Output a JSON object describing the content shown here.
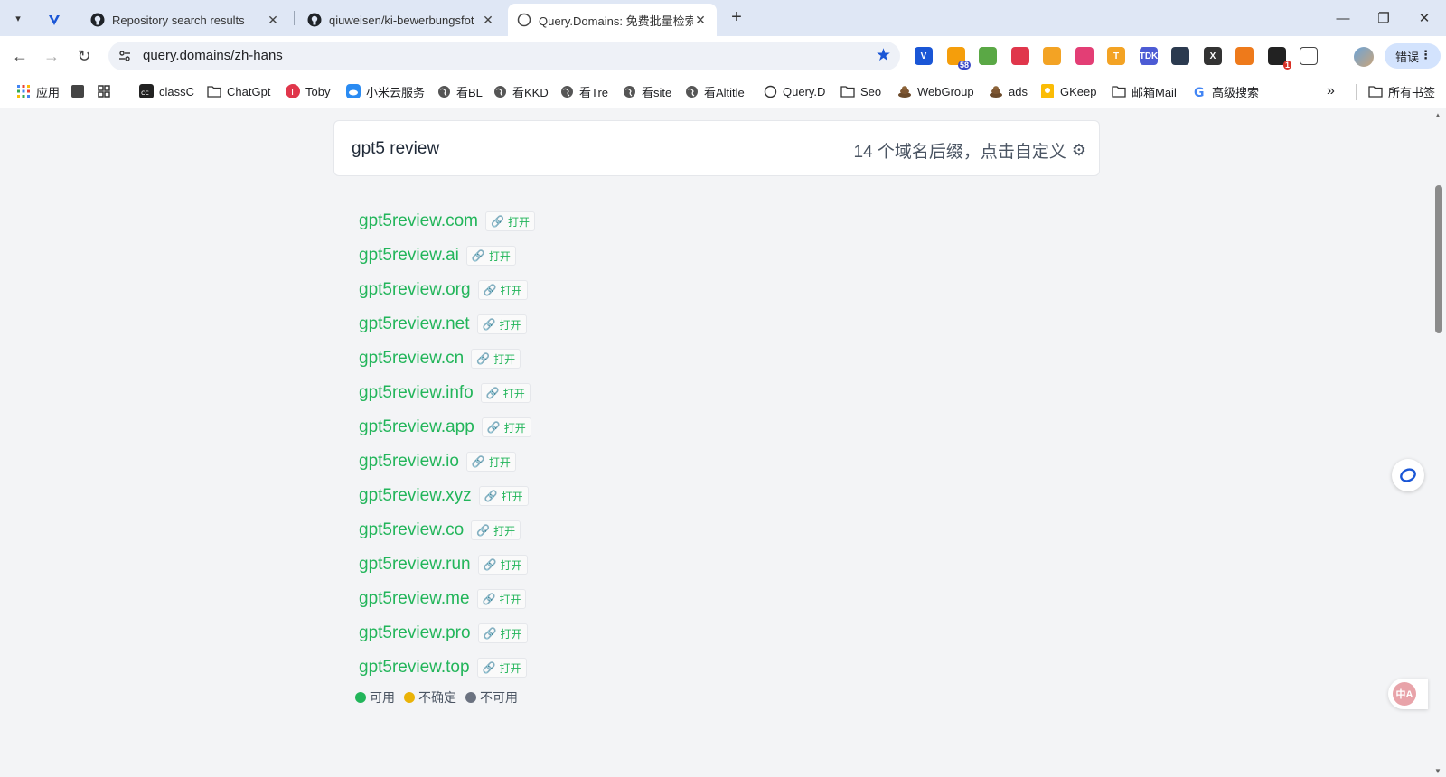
{
  "browser": {
    "tabs": [
      {
        "title": "",
        "icon": "vivaldi-like-icon"
      },
      {
        "title": "Repository search results",
        "icon": "github-icon"
      },
      {
        "title": "qiuweisen/ki-bewerbungsfot",
        "icon": "github-icon"
      },
      {
        "title": "Query.Domains: 免费批量检索",
        "icon": "globe-icon",
        "active": true
      }
    ],
    "new_tab_label": "+",
    "window_controls": {
      "minimize": "—",
      "restore": "❐",
      "close": "✕"
    }
  },
  "toolbar": {
    "url": "query.domains/zh-hans",
    "error_label": "错误",
    "extensions": [
      {
        "name": "blue-v-ext-icon",
        "color": "#1a56d6",
        "label": "V"
      },
      {
        "name": "rss-ext-icon",
        "color": "#f59e0b",
        "label": "",
        "badge": "58"
      },
      {
        "name": "green-ext-icon",
        "color": "#5aa845",
        "label": ""
      },
      {
        "name": "red-ext-icon",
        "color": "#e0364b",
        "label": ""
      },
      {
        "name": "orange-gauge-ext-icon",
        "color": "#f3a324",
        "label": ""
      },
      {
        "name": "pink-ext-icon",
        "color": "#e33e75",
        "label": ""
      },
      {
        "name": "tshape-ext-icon",
        "color": "#f3a324",
        "label": "T"
      },
      {
        "name": "tdk-ext-icon",
        "color": "#4c5bd4",
        "label": "TDK"
      },
      {
        "name": "dark-ext-icon",
        "color": "#2b3a4f",
        "label": ""
      },
      {
        "name": "x-ext-icon",
        "color": "#333333",
        "label": "X"
      },
      {
        "name": "orange-ext-icon",
        "color": "#ee7a1b",
        "label": ""
      },
      {
        "name": "black-ext-icon",
        "color": "#222222",
        "label": "",
        "badge": "1"
      },
      {
        "name": "puzzle-ext-icon",
        "color": "#ffffff",
        "label": ""
      }
    ]
  },
  "bookmarks": {
    "items": [
      {
        "label": "应用",
        "icon": "apps-grid-icon"
      },
      {
        "label": "",
        "icon": "dark-square-icon"
      },
      {
        "label": "",
        "icon": "grid-icon"
      },
      {
        "label": "classC",
        "icon": "cc-icon"
      },
      {
        "label": "ChatGpt",
        "icon": "folder-icon"
      },
      {
        "label": "Toby",
        "icon": "toby-icon"
      },
      {
        "label": "小米云服务",
        "icon": "cloud-icon"
      },
      {
        "label": "看BL",
        "icon": "globe-icon"
      },
      {
        "label": "看KKD",
        "icon": "globe-icon"
      },
      {
        "label": "看Tre",
        "icon": "globe-icon"
      },
      {
        "label": "看site",
        "icon": "globe-icon"
      },
      {
        "label": "看Altitle",
        "icon": "globe-icon"
      },
      {
        "label": "Query.D",
        "icon": "circle-icon"
      },
      {
        "label": "Seo",
        "icon": "folder-icon"
      },
      {
        "label": "WebGroup",
        "icon": "poop-icon"
      },
      {
        "label": "ads",
        "icon": "poop-icon"
      },
      {
        "label": "GKeep",
        "icon": "keep-icon"
      },
      {
        "label": "邮箱Mail",
        "icon": "folder-icon"
      },
      {
        "label": "高级搜索",
        "icon": "google-icon"
      }
    ],
    "overflow_label": "»",
    "all_bookmarks_label": "所有书签"
  },
  "search": {
    "query": "gpt5 review",
    "suffix_info": "14 个域名后缀，点击自定义"
  },
  "domains": [
    {
      "name": "gpt5review.com",
      "open_label": "打开"
    },
    {
      "name": "gpt5review.ai",
      "open_label": "打开"
    },
    {
      "name": "gpt5review.org",
      "open_label": "打开"
    },
    {
      "name": "gpt5review.net",
      "open_label": "打开"
    },
    {
      "name": "gpt5review.cn",
      "open_label": "打开"
    },
    {
      "name": "gpt5review.info",
      "open_label": "打开"
    },
    {
      "name": "gpt5review.app",
      "open_label": "打开"
    },
    {
      "name": "gpt5review.io",
      "open_label": "打开"
    },
    {
      "name": "gpt5review.xyz",
      "open_label": "打开"
    },
    {
      "name": "gpt5review.co",
      "open_label": "打开"
    },
    {
      "name": "gpt5review.run",
      "open_label": "打开"
    },
    {
      "name": "gpt5review.me",
      "open_label": "打开"
    },
    {
      "name": "gpt5review.pro",
      "open_label": "打开"
    },
    {
      "name": "gpt5review.top",
      "open_label": "打开"
    }
  ],
  "legend": [
    {
      "label": "可用",
      "color": "#22b55a"
    },
    {
      "label": "不确定",
      "color": "#eab308"
    },
    {
      "label": "不可用",
      "color": "#6b7280"
    }
  ],
  "colors": {
    "available": "#22b55a",
    "accent": "#1a56d6"
  }
}
